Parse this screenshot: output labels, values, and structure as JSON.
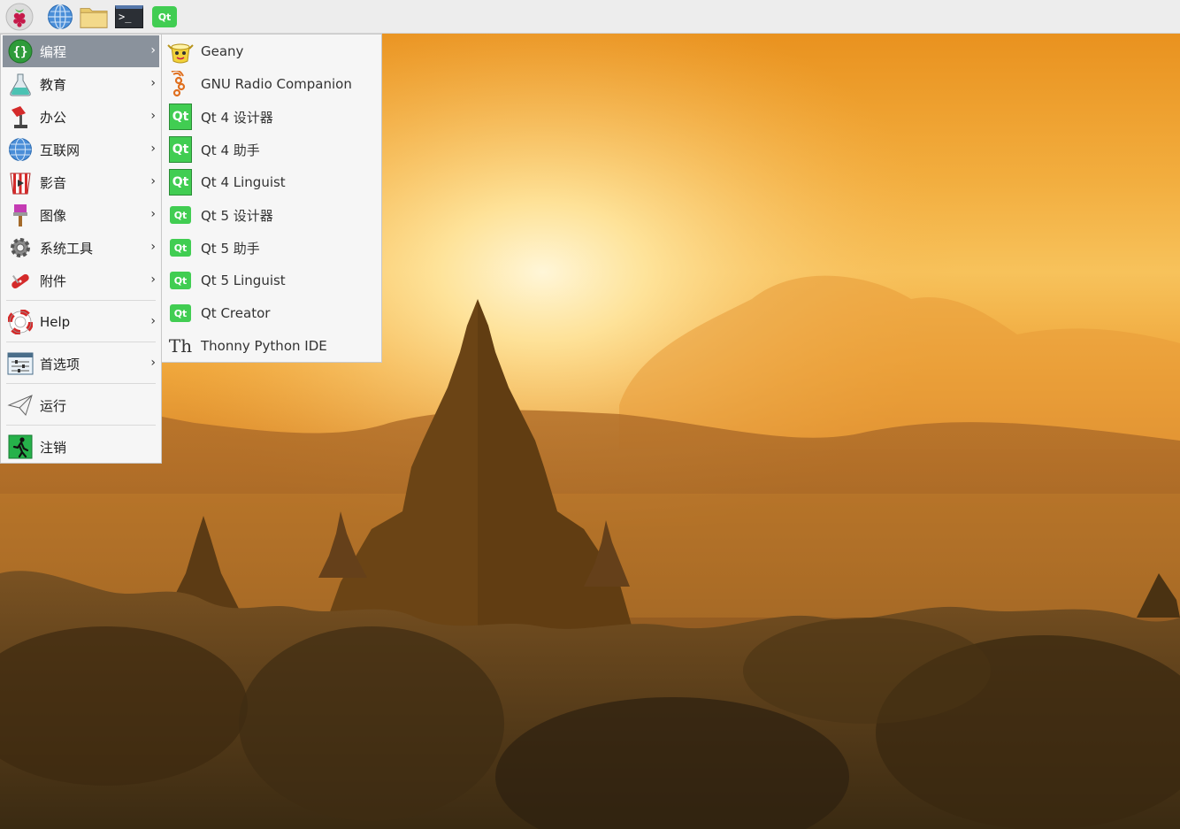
{
  "panel": {
    "launchers": [
      {
        "name": "raspberry-menu-icon"
      },
      {
        "name": "web-browser-icon"
      },
      {
        "name": "file-manager-icon"
      },
      {
        "name": "terminal-icon"
      },
      {
        "name": "qt-creator-icon"
      }
    ]
  },
  "main_menu": {
    "items": [
      {
        "label": "编程",
        "icon": "programming-icon",
        "has_submenu": true,
        "active": true
      },
      {
        "label": "教育",
        "icon": "education-icon",
        "has_submenu": true
      },
      {
        "label": "办公",
        "icon": "office-icon",
        "has_submenu": true
      },
      {
        "label": "互联网",
        "icon": "internet-icon",
        "has_submenu": true
      },
      {
        "label": "影音",
        "icon": "multimedia-icon",
        "has_submenu": true
      },
      {
        "label": "图像",
        "icon": "graphics-icon",
        "has_submenu": true
      },
      {
        "label": "系统工具",
        "icon": "system-tools-icon",
        "has_submenu": true
      },
      {
        "label": "附件",
        "icon": "accessories-icon",
        "has_submenu": true
      },
      {
        "label": "Help",
        "icon": "help-icon",
        "has_submenu": true
      },
      {
        "label": "首选项",
        "icon": "preferences-icon",
        "has_submenu": true
      },
      {
        "label": "运行",
        "icon": "run-icon",
        "has_submenu": false
      },
      {
        "label": "注销",
        "icon": "logout-icon",
        "has_submenu": false
      }
    ],
    "arrow": "›"
  },
  "programming_submenu": {
    "items": [
      {
        "label": "Geany",
        "icon": "geany-icon"
      },
      {
        "label": "GNU Radio Companion",
        "icon": "gnu-radio-icon"
      },
      {
        "label": "Qt 4 设计器",
        "icon": "qt4-designer-icon",
        "badge": "Qt"
      },
      {
        "label": "Qt 4 助手",
        "icon": "qt4-assistant-icon",
        "badge": "Qt"
      },
      {
        "label": "Qt 4 Linguist",
        "icon": "qt4-linguist-icon",
        "badge": "Qt"
      },
      {
        "label": "Qt 5 设计器",
        "icon": "qt5-designer-icon",
        "badge": "Qt"
      },
      {
        "label": "Qt 5 助手",
        "icon": "qt5-assistant-icon",
        "badge": "Qt"
      },
      {
        "label": "Qt 5 Linguist",
        "icon": "qt5-linguist-icon",
        "badge": "Qt"
      },
      {
        "label": "Qt Creator",
        "icon": "qt-creator-icon",
        "badge": "Qt"
      },
      {
        "label": "Thonny Python IDE",
        "icon": "thonny-icon",
        "badge": "Th"
      }
    ]
  },
  "colors": {
    "panel_bg": "#ededed",
    "menu_bg": "#f6f6f6",
    "highlight": "#8a929c",
    "qt_green": "#41cd52"
  },
  "terminal_glyph": ">_",
  "qt_badge": "Qt"
}
